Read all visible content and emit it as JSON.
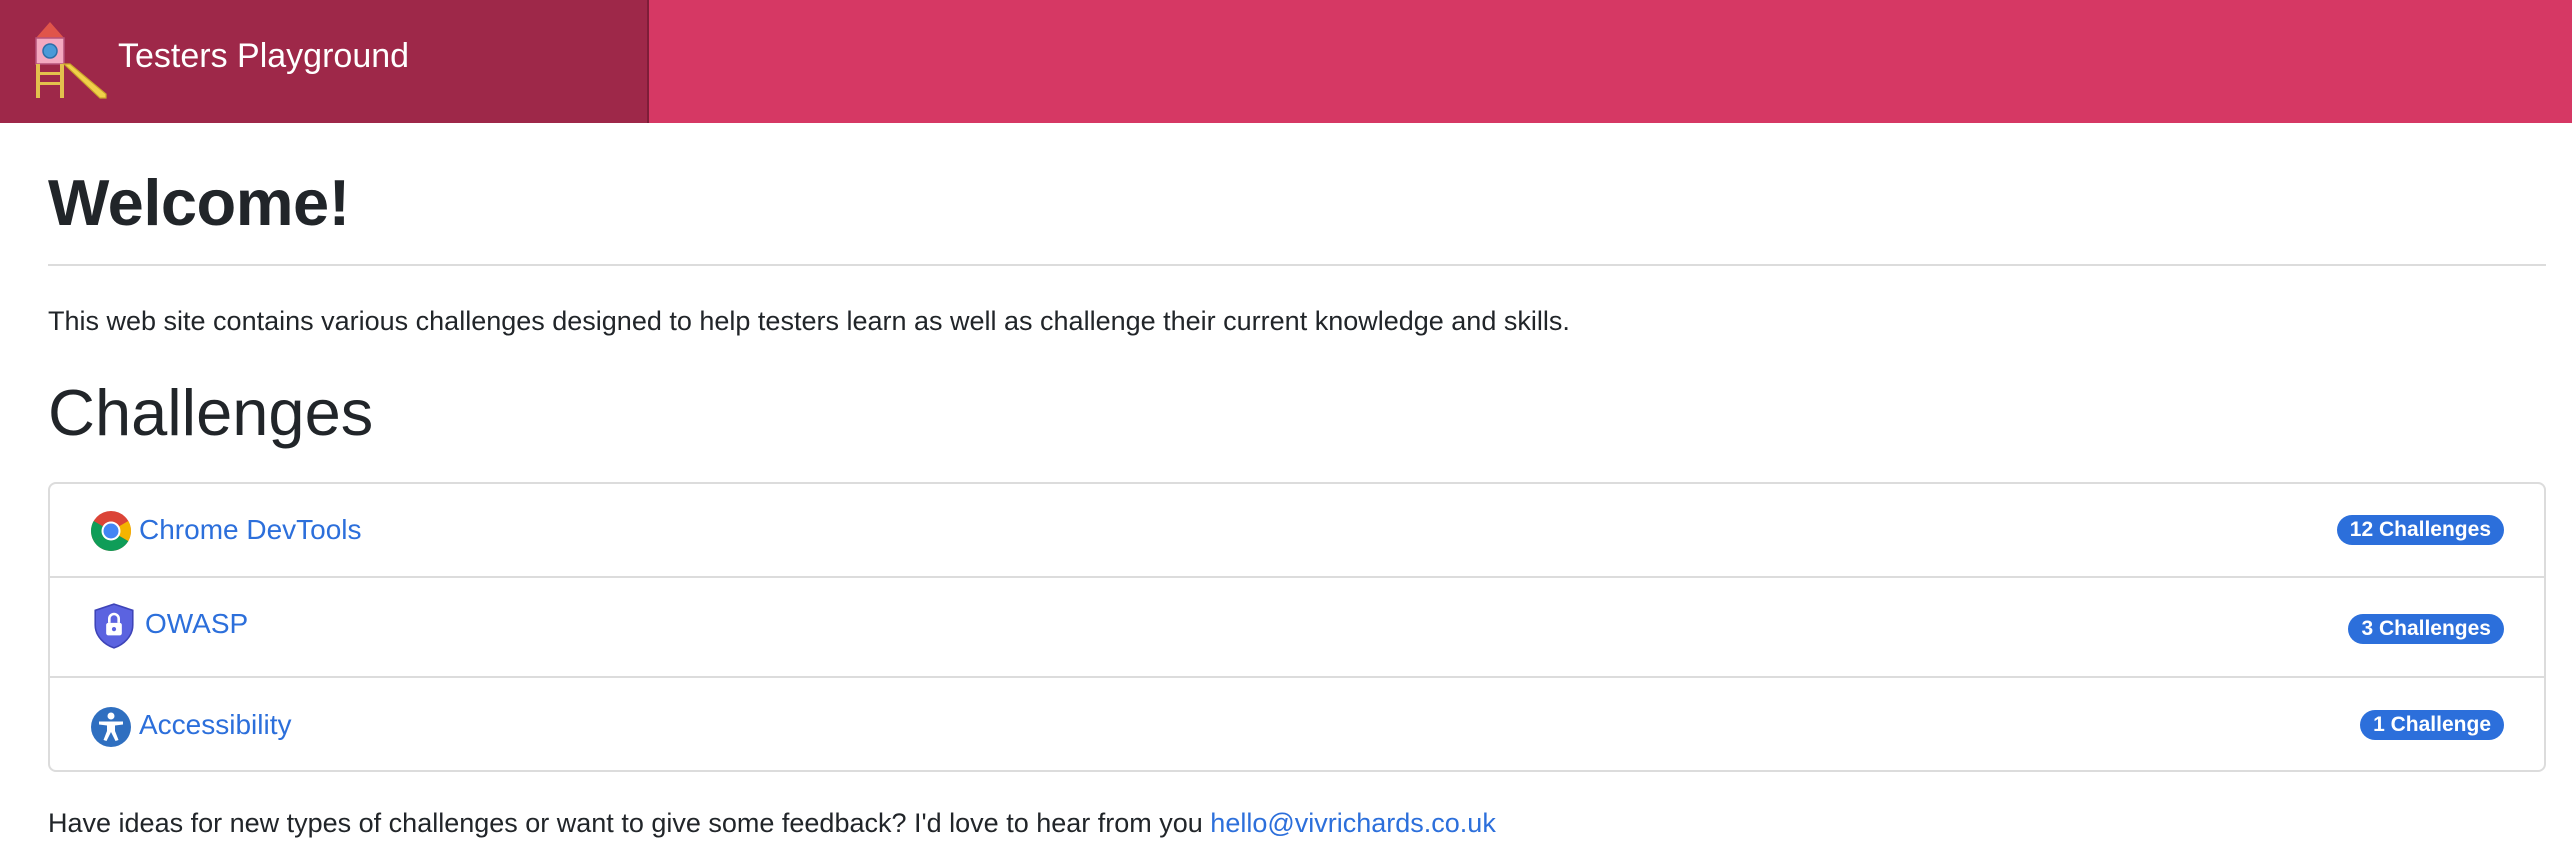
{
  "navbar": {
    "brand_title": "Testers Playground",
    "brand_icon": "playground-slide-icon",
    "colors": {
      "navbar_bg": "#d63864",
      "brand_bg": "#9e2849"
    }
  },
  "main": {
    "welcome_heading": "Welcome!",
    "intro_text": "This web site contains various challenges designed to help testers learn as well as challenge their current knowledge and skills.",
    "challenges_heading": "Challenges",
    "challenges": [
      {
        "label": "Chrome DevTools",
        "badge": "12 Challenges",
        "icon": "chrome-icon"
      },
      {
        "label": "OWASP",
        "badge": "3 Challenges",
        "icon": "shield-lock-icon"
      },
      {
        "label": "Accessibility",
        "badge": "1 Challenge",
        "icon": "accessibility-icon"
      }
    ],
    "footer_text": "Have ideas for new types of challenges or want to give some feedback? I'd love to hear from you ",
    "footer_email": "hello@vivrichards.co.uk",
    "colors": {
      "link": "#2c6fdb",
      "badge_bg": "#2c6fdb"
    }
  }
}
